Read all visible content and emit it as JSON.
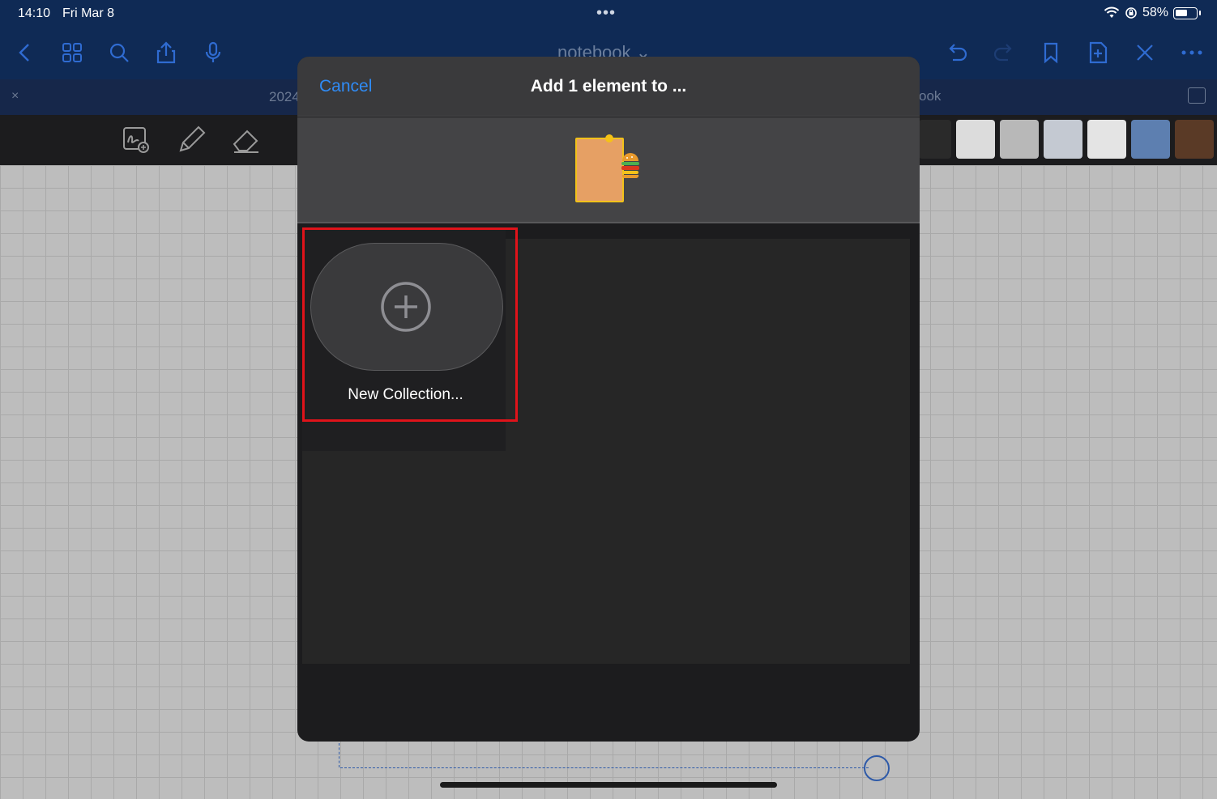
{
  "status_bar": {
    "time": "14:10",
    "date": "Fri Mar 8",
    "battery": "58%",
    "multitask_dots": "•••"
  },
  "app": {
    "title": "notebook ⌄",
    "tab_close": "×",
    "tab_left_label": "2024",
    "tab_right_label": "ook",
    "accent_color": "#2f6bd1"
  },
  "modal": {
    "cancel_label": "Cancel",
    "title": "Add 1 element to ...",
    "new_collection_label": "New Collection...",
    "cancel_color": "#2f8bf5",
    "highlight_color": "#e0131a"
  }
}
